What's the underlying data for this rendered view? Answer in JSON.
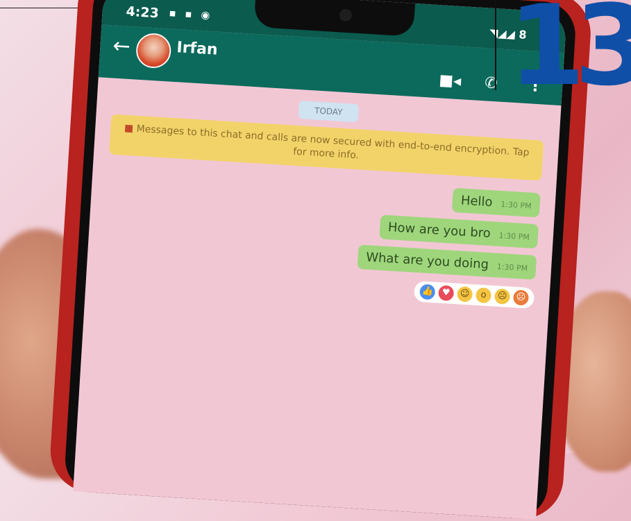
{
  "status": {
    "time": "4:23",
    "right_text": "8"
  },
  "chat": {
    "contact_name": "Irfan",
    "date_chip": "TODAY",
    "encryption_notice": "Messages to this chat and calls are now secured with end-to-end encryption. Tap for more info.",
    "messages": [
      {
        "text": "Hello",
        "time": "1:30 PM"
      },
      {
        "text": "How are you bro",
        "time": "1:30 PM"
      },
      {
        "text": "What are you doing",
        "time": "1:30 PM"
      }
    ]
  },
  "badge_number": "13",
  "colors": {
    "phone_body": "#b8221f",
    "app_bar": "#0b6a5c",
    "chat_bg": "#f2c7d4",
    "bubble": "#9fd67c",
    "badge": "#0f4fa8"
  }
}
